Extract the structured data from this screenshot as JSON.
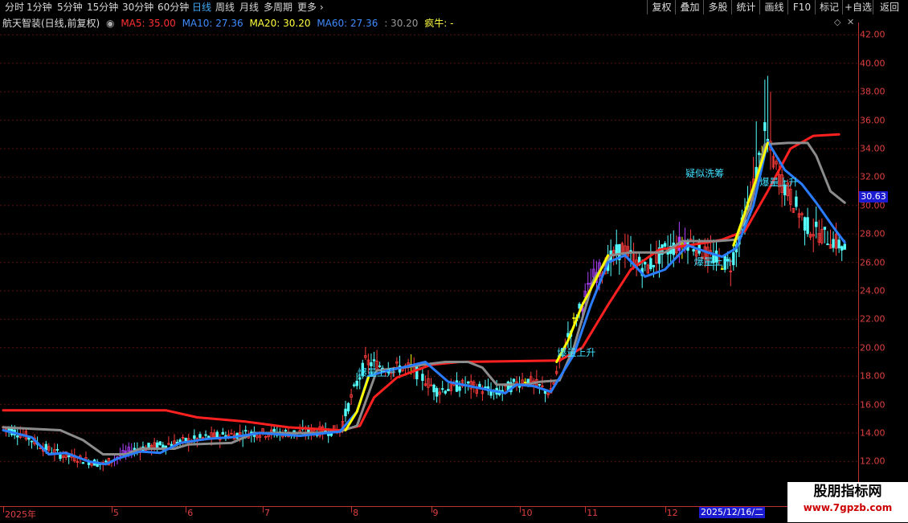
{
  "toolbar": {
    "periods": [
      "分时",
      "1分钟",
      "5分钟",
      "15分钟",
      "30分钟",
      "60分钟",
      "日线",
      "周线",
      "月线",
      "多周期",
      "更多"
    ],
    "active_period": "日线",
    "right_tabs": [
      "复权",
      "叠加",
      "多股",
      "统计",
      "画线",
      "F10",
      "标记",
      "+自选",
      "返回"
    ]
  },
  "header": {
    "title": "航天智装(日线,前复权)",
    "ma5": "MA5: 35.00",
    "ma10": "MA10: 27.36",
    "ma20": "MA20: 30.20",
    "ma60": "MA60: 27.36",
    "extra": ": 30.20",
    "crazy": "疯牛: -"
  },
  "colors": {
    "up": "#ff3c3c",
    "down": "#54ffff",
    "ma_red": "#ff2020",
    "ma_gray": "#8c8c8c",
    "ma_blue": "#2a7cff",
    "ma_yellow": "#ffff00",
    "bg": "#000000",
    "grid": "#5a1010"
  },
  "chart_data": {
    "type": "candlestick",
    "ylim": [
      11,
      43
    ],
    "y_ticks": [
      "12.00",
      "14.00",
      "16.00",
      "18.00",
      "20.00",
      "22.00",
      "24.00",
      "26.00",
      "28.00",
      "30.00",
      "32.00",
      "34.00",
      "36.00",
      "38.00",
      "40.00",
      "42.00"
    ],
    "current_price": "30.63",
    "x_ticks": [
      "2025年",
      "5",
      "6",
      "7",
      "8",
      "9",
      "10",
      "11",
      "12"
    ],
    "cursor_date": "2025/12/16/二",
    "annotations": [
      {
        "text": "疑似洗筹",
        "bar": 242,
        "price": 32.3
      },
      {
        "text": "爆量上升",
        "bar": 127,
        "price": 18.3
      },
      {
        "text": "爆量上升",
        "bar": 197,
        "price": 19.7
      },
      {
        "text": "爆量上升",
        "bar": 245,
        "price": 26.1
      },
      {
        "text": "爆量上升",
        "bar": 268,
        "price": 31.7
      }
    ],
    "anchors": [
      [
        0,
        14.4
      ],
      [
        8,
        13.8
      ],
      [
        14,
        13.0
      ],
      [
        20,
        12.5
      ],
      [
        35,
        11.8
      ],
      [
        45,
        12.8
      ],
      [
        60,
        13.3
      ],
      [
        75,
        13.8
      ],
      [
        88,
        14.0
      ],
      [
        100,
        14.0
      ],
      [
        118,
        14.2
      ],
      [
        122,
        16.5
      ],
      [
        127,
        19.0
      ],
      [
        135,
        18.6
      ],
      [
        143,
        18.6
      ],
      [
        152,
        17.0
      ],
      [
        162,
        17.4
      ],
      [
        173,
        16.8
      ],
      [
        183,
        17.8
      ],
      [
        192,
        16.8
      ],
      [
        197,
        20.3
      ],
      [
        207,
        25.0
      ],
      [
        217,
        27.0
      ],
      [
        225,
        25.5
      ],
      [
        232,
        26.8
      ],
      [
        240,
        27.5
      ],
      [
        247,
        26.5
      ],
      [
        255,
        25.8
      ],
      [
        262,
        30.5
      ],
      [
        267,
        35.0
      ],
      [
        272,
        32.0
      ],
      [
        282,
        28.5
      ],
      [
        292,
        27.4
      ],
      [
        295,
        27.0
      ]
    ],
    "ma_lines": [
      {
        "name": "MA60",
        "color": "#ff2020",
        "points": [
          [
            0,
            15.6
          ],
          [
            57,
            15.6
          ],
          [
            68,
            15.1
          ],
          [
            85,
            14.8
          ],
          [
            100,
            14.4
          ],
          [
            118,
            14.2
          ],
          [
            125,
            14.5
          ],
          [
            130,
            16.5
          ],
          [
            138,
            17.9
          ],
          [
            150,
            18.8
          ],
          [
            160,
            19.0
          ],
          [
            195,
            19.1
          ],
          [
            203,
            20.0
          ],
          [
            212,
            23.0
          ],
          [
            220,
            25.5
          ],
          [
            230,
            26.9
          ],
          [
            240,
            27.2
          ],
          [
            247,
            27.4
          ],
          [
            252,
            27.6
          ],
          [
            260,
            28.2
          ],
          [
            268,
            31.0
          ],
          [
            276,
            34.0
          ],
          [
            284,
            34.9
          ],
          [
            293,
            35.0
          ]
        ]
      },
      {
        "name": "MA20",
        "color": "#8c8c8c",
        "points": [
          [
            0,
            14.4
          ],
          [
            10,
            14.3
          ],
          [
            20,
            14.2
          ],
          [
            28,
            13.5
          ],
          [
            35,
            12.5
          ],
          [
            43,
            12.5
          ],
          [
            48,
            12.9
          ],
          [
            60,
            12.9
          ],
          [
            65,
            13.2
          ],
          [
            80,
            13.3
          ],
          [
            88,
            14.0
          ],
          [
            95,
            14.0
          ],
          [
            110,
            14.0
          ],
          [
            118,
            14.1
          ],
          [
            124,
            14.5
          ],
          [
            131,
            18.4
          ],
          [
            140,
            18.6
          ],
          [
            147,
            18.8
          ],
          [
            155,
            19.0
          ],
          [
            163,
            19.0
          ],
          [
            168,
            18.6
          ],
          [
            173,
            17.4
          ],
          [
            183,
            17.4
          ],
          [
            188,
            17.6
          ],
          [
            195,
            17.7
          ],
          [
            200,
            20.0
          ],
          [
            207,
            24.8
          ],
          [
            213,
            26.5
          ],
          [
            220,
            26.7
          ],
          [
            232,
            26.7
          ],
          [
            238,
            27.5
          ],
          [
            250,
            27.5
          ],
          [
            257,
            27.6
          ],
          [
            262,
            30.0
          ],
          [
            267,
            34.3
          ],
          [
            275,
            34.4
          ],
          [
            282,
            34.4
          ],
          [
            285,
            33.5
          ],
          [
            290,
            31.0
          ],
          [
            295,
            30.2
          ]
        ]
      },
      {
        "name": "MA10",
        "color": "#2a7cff",
        "points": [
          [
            0,
            14.2
          ],
          [
            10,
            13.7
          ],
          [
            16,
            12.5
          ],
          [
            22,
            12.6
          ],
          [
            30,
            12.0
          ],
          [
            36,
            11.8
          ],
          [
            40,
            12.2
          ],
          [
            48,
            12.7
          ],
          [
            55,
            12.6
          ],
          [
            62,
            13.3
          ],
          [
            72,
            13.6
          ],
          [
            80,
            13.7
          ],
          [
            90,
            14.0
          ],
          [
            104,
            13.8
          ],
          [
            118,
            14.1
          ],
          [
            124,
            15.5
          ],
          [
            128,
            18.0
          ],
          [
            135,
            18.4
          ],
          [
            142,
            18.7
          ],
          [
            148,
            19.0
          ],
          [
            156,
            17.6
          ],
          [
            166,
            17.2
          ],
          [
            176,
            16.8
          ],
          [
            180,
            17.4
          ],
          [
            186,
            17.3
          ],
          [
            192,
            16.9
          ],
          [
            200,
            19.5
          ],
          [
            206,
            23.0
          ],
          [
            212,
            26.0
          ],
          [
            218,
            26.5
          ],
          [
            225,
            25.0
          ],
          [
            232,
            25.5
          ],
          [
            240,
            27.2
          ],
          [
            247,
            26.7
          ],
          [
            252,
            26.4
          ],
          [
            257,
            27.0
          ],
          [
            263,
            30.0
          ],
          [
            268,
            34.5
          ],
          [
            274,
            32.5
          ],
          [
            280,
            31.5
          ],
          [
            285,
            30.2
          ],
          [
            292,
            28.2
          ],
          [
            295,
            27.4
          ]
        ]
      },
      {
        "name": "MA5",
        "color": "#ffff00",
        "points": [
          [
            120,
            14.2
          ],
          [
            124,
            15.5
          ],
          [
            128,
            17.9
          ]
        ]
      },
      {
        "name": "MA5b",
        "color": "#ffff00",
        "points": [
          [
            194,
            19.0
          ],
          [
            198,
            20.5
          ],
          [
            203,
            23.0
          ],
          [
            207,
            24.5
          ],
          [
            212,
            26.5
          ]
        ]
      },
      {
        "name": "MA5c",
        "color": "#ffff00",
        "points": [
          [
            256,
            27.2
          ],
          [
            260,
            29.5
          ],
          [
            265,
            32.5
          ],
          [
            268,
            34.4
          ]
        ]
      }
    ]
  },
  "watermark": {
    "line1": "股朋指标网",
    "line2": "www.7gpzb.com"
  }
}
